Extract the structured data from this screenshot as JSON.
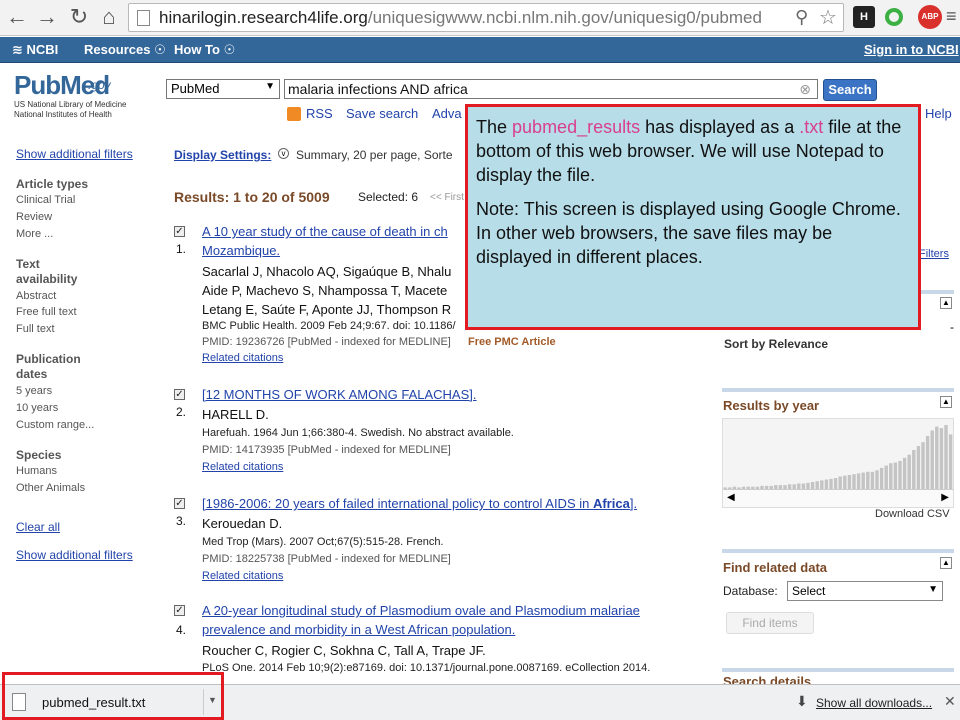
{
  "browser": {
    "url_host": "hinarilogin.research4life.org",
    "url_path": "/uniquesigwww.ncbi.nlm.nih.gov/uniquesig0/pubmed",
    "ext_labels": [
      "H",
      "ABP"
    ]
  },
  "ncbi_bar": {
    "logo": "NCBI",
    "resources": "Resources ☉",
    "howto": "How To ☉",
    "signin": "Sign in to NCBI"
  },
  "header": {
    "logo_main": "PubMed",
    "logo_gov": ".gov",
    "logo_sub1": "US National Library of Medicine",
    "logo_sub2": "National Institutes of Health",
    "db_value": "PubMed",
    "search_value": "malaria infections AND africa",
    "search_button": "Search",
    "rss": "RSS",
    "save_search": "Save search",
    "advanced": "Adva",
    "help": "Help"
  },
  "sidebar": {
    "show_filters_top": "Show additional filters",
    "sections": [
      {
        "head": "Article types",
        "items": [
          "Clinical Trial",
          "Review",
          "More ..."
        ]
      },
      {
        "head": "Text availability",
        "items": [
          "Abstract",
          "Free full text",
          "Full text"
        ]
      },
      {
        "head": "Publication dates",
        "items": [
          "5 years",
          "10 years",
          "Custom range..."
        ]
      },
      {
        "head": "Species",
        "items": [
          "Humans",
          "Other Animals"
        ]
      }
    ],
    "clear_all": "Clear all",
    "show_filters_bottom": "Show additional filters"
  },
  "main": {
    "display_settings": "Display Settings:",
    "display_summary": "Summary, 20 per page, Sorte",
    "results_count": "Results: 1 to 20 of 5009",
    "selected": "Selected: 6",
    "first_nav": "<< First",
    "results": [
      {
        "num": "1.",
        "title_l1": "A 10 year study of the cause of death in ch",
        "title_l2": "Mozambique.",
        "auth_l1": "Sacarlal J, Nhacolo AQ, Sigaúque B, Nhalu",
        "auth_l2": "Aide P, Machevo S, Nhampossa T, Macete",
        "auth_l3": "Letang E, Saúte F, Aponte JJ, Thompson R",
        "meta": "BMC Public Health. 2009 Feb 24;9:67. doi: 10.1186/",
        "pmid": "PMID: 19236726 [PubMed - indexed for MEDLINE]",
        "free": "Free PMC Article",
        "related": "Related citations"
      },
      {
        "num": "2.",
        "title_l1": "[12 MONTHS OF WORK AMONG FALACHAS].",
        "auth_l1": "HARELL D.",
        "meta": "Harefuah. 1964 Jun 1;66:380-4. Swedish. No abstract available.",
        "pmid": "PMID: 14173935 [PubMed - indexed for MEDLINE]",
        "related": "Related citations"
      },
      {
        "num": "3.",
        "title_l1a": "[1986-2006: 20 years of failed international policy to control AIDS in ",
        "title_l1b": "Africa",
        "title_l1c": "].",
        "auth_l1": "Kerouedan D.",
        "meta": "Med Trop (Mars). 2007 Oct;67(5):515-28. French.",
        "pmid": "PMID: 18225738 [PubMed - indexed for MEDLINE]",
        "related": "Related citations"
      },
      {
        "num": "4.",
        "title_l1": "A 20-year longitudinal study of Plasmodium ovale and Plasmodium malariae",
        "title_l2": "prevalence and morbidity in a West African population.",
        "auth_l1": "Roucher C, Rogier C, Sokhna C, Tall A, Trape JF.",
        "meta": "PLoS One. 2014 Feb 10;9(2):e87169. doi: 10.1371/journal.pone.0087169. eCollection 2014."
      }
    ]
  },
  "right": {
    "filters": "Filters",
    "sort_relevance": "Sort by Relevance",
    "dash": "-",
    "results_by_year": "Results by year",
    "download_csv": "Download CSV",
    "find_related": "Find related data",
    "database_label": "Database:",
    "database_value": "Select",
    "find_items": "Find items",
    "search_details": "Search details"
  },
  "callout": {
    "p1_a": "The ",
    "p1_b": "pubmed_results",
    "p1_c": " has displayed as a ",
    "p1_d": ".txt",
    "p1_e": " file at the bottom of this web browser. We will use Notepad to display the file.",
    "p2": "Note: This screen is displayed using Google Chrome.  In other web browsers, the save files may be displayed in different places."
  },
  "download_bar": {
    "filename": "pubmed_result.txt",
    "show_all": "Show all downloads..."
  },
  "chart_data": {
    "type": "bar",
    "title": "Results by year",
    "values": [
      2,
      2,
      3,
      2,
      3,
      3,
      3,
      3,
      4,
      4,
      4,
      5,
      5,
      5,
      6,
      6,
      7,
      7,
      8,
      9,
      10,
      11,
      12,
      13,
      14,
      16,
      17,
      18,
      19,
      20,
      21,
      22,
      22,
      24,
      27,
      30,
      33,
      34,
      36,
      40,
      44,
      50,
      55,
      60,
      68,
      75,
      80,
      78,
      82,
      70
    ]
  }
}
